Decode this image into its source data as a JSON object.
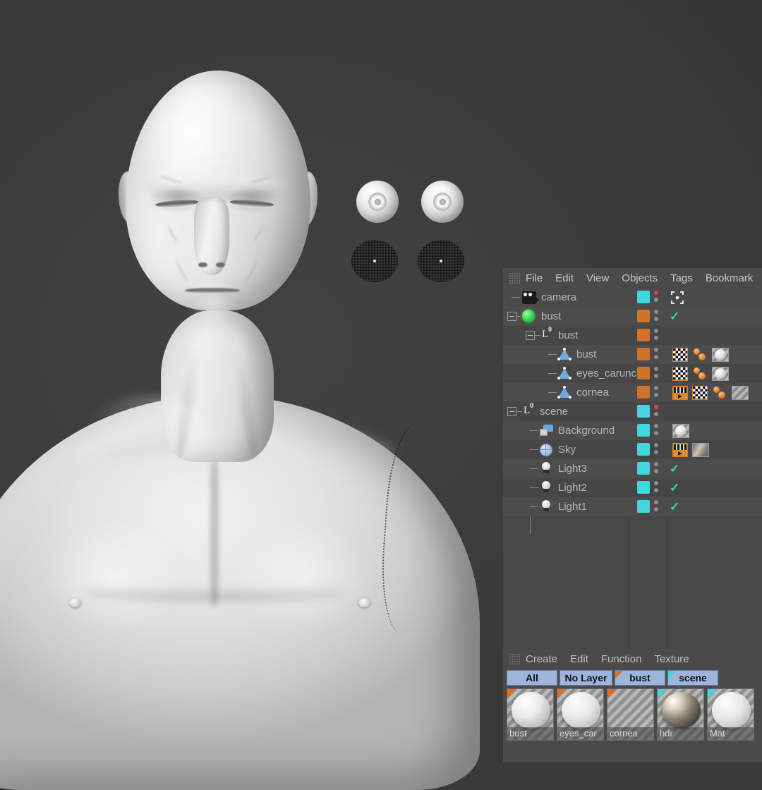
{
  "viewport": {
    "name": "3d-viewport",
    "background_color": "#3a3a3a",
    "objects": [
      "bust",
      "eyes_caruncle",
      "cornea"
    ]
  },
  "object_manager": {
    "menu": [
      "File",
      "Edit",
      "View",
      "Objects",
      "Tags",
      "Bookmark"
    ],
    "rows": [
      {
        "name": "camera",
        "icon": "camera-icon",
        "depth": 1,
        "layer_color": "#3fd8e0",
        "dot_red": true,
        "check": false,
        "expander": false,
        "tags": []
      },
      {
        "name": "bust",
        "icon": "null-object-icon",
        "depth": 0,
        "layer_color": "#d1712a",
        "dot_red": false,
        "check": true,
        "expander": true,
        "tags": []
      },
      {
        "name": "bust",
        "icon": "layer-icon",
        "depth": 1,
        "layer_color": "#d1712a",
        "dot_red": false,
        "check": false,
        "expander": true,
        "tags": []
      },
      {
        "name": "bust",
        "icon": "polygon-icon",
        "depth": 2,
        "layer_color": "#d1712a",
        "dot_red": false,
        "check": false,
        "expander": false,
        "tags": [
          "texture-tag",
          "phong-tag",
          "material-tag"
        ]
      },
      {
        "name": "eyes_caruncle",
        "icon": "polygon-icon",
        "depth": 2,
        "layer_color": "#d1712a",
        "dot_red": false,
        "check": false,
        "expander": false,
        "tags": [
          "texture-tag",
          "phong-tag",
          "material-tag"
        ]
      },
      {
        "name": "cornea",
        "icon": "polygon-icon",
        "depth": 2,
        "layer_color": "#d1712a",
        "dot_red": false,
        "check": false,
        "expander": false,
        "tags": [
          "render-tag",
          "texture-tag",
          "phong-tag",
          "glass-material-tag"
        ]
      },
      {
        "name": "scene",
        "icon": "layer-icon",
        "depth": 0,
        "layer_color": "#3fd8e0",
        "dot_red": true,
        "check": false,
        "expander": true,
        "tags": []
      },
      {
        "name": "Background",
        "icon": "background-icon",
        "depth": 1,
        "layer_color": "#3fd8e0",
        "dot_red": false,
        "check": false,
        "expander": false,
        "tags": [
          "material-tag"
        ]
      },
      {
        "name": "Sky",
        "icon": "sky-icon",
        "depth": 1,
        "layer_color": "#3fd8e0",
        "dot_red": false,
        "check": false,
        "expander": false,
        "tags": [
          "render-tag",
          "hdr-material-tag"
        ]
      },
      {
        "name": "Light3",
        "icon": "light-icon",
        "depth": 1,
        "layer_color": "#3fd8e0",
        "dot_red": false,
        "check": true,
        "expander": false,
        "tags": []
      },
      {
        "name": "Light2",
        "icon": "light-icon",
        "depth": 1,
        "layer_color": "#3fd8e0",
        "dot_red": false,
        "check": true,
        "expander": false,
        "tags": []
      },
      {
        "name": "Light1",
        "icon": "light-icon",
        "depth": 1,
        "layer_color": "#3fd8e0",
        "dot_red": false,
        "check": true,
        "expander": false,
        "tags": []
      }
    ]
  },
  "material_manager": {
    "menu": [
      "Create",
      "Edit",
      "Function",
      "Texture"
    ],
    "layer_tabs": [
      {
        "label": "All",
        "corner": "none"
      },
      {
        "label": "No Layer",
        "corner": "none"
      },
      {
        "label": "bust",
        "corner": "#e06c1e"
      },
      {
        "label": "scene",
        "corner": "#3fd8e0"
      }
    ],
    "materials": [
      {
        "label": "bust",
        "corner": "#e06c1e",
        "preview": "rough-white-sphere"
      },
      {
        "label": "eyes_car",
        "corner": "#e06c1e",
        "preview": "speckled-white-sphere"
      },
      {
        "label": "cornea",
        "corner": "#e06c1e",
        "preview": "transparent-glass"
      },
      {
        "label": "hdr",
        "corner": "#3fd8e0",
        "preview": "chrome-hdr-sphere"
      },
      {
        "label": "Mat",
        "corner": "#3fd8e0",
        "preview": "plain-white-sphere"
      }
    ]
  },
  "colors": {
    "panel_bg": "#474747",
    "menu_bg": "#4a4a4a",
    "row_alt": "#4c4c4c",
    "text": "#b6b6b6",
    "layer_cyan": "#3fd8e0",
    "layer_orange": "#d1712a",
    "check_green": "#3ddc84",
    "dot_red": "#e8463c",
    "tab_blue": "#9db4dc"
  }
}
